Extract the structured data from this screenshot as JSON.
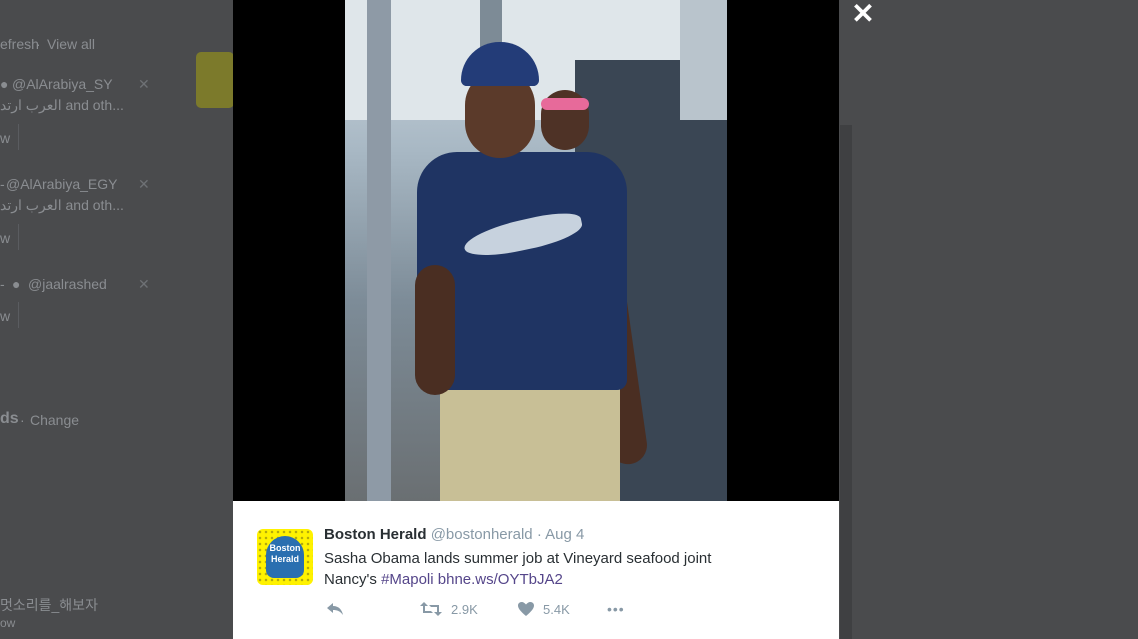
{
  "background": {
    "refresh": "efresh",
    "view_all": "View all",
    "suggestions": [
      {
        "handle": "@AlArabiya_SY",
        "sub": "العرب ارتد and oth...",
        "follow": "w"
      },
      {
        "handle": "@AlArabiya_EGY",
        "sub": "العرب ارتد and oth...",
        "follow": "w"
      },
      {
        "handle": "@jaalrashed",
        "sub": "",
        "follow": "w"
      }
    ],
    "trends_suffix": "ds",
    "change": "Change",
    "korean": "멋소리를_해보자",
    "korean_sub": "ow"
  },
  "viewer": {
    "close_label": "✕"
  },
  "tweet": {
    "name": "Boston Herald",
    "handle": "@bostonherald",
    "separator": "·",
    "date": "Aug 4",
    "text_line1": "Sasha Obama lands summer job at Vineyard seafood joint",
    "text_prefix": "Nancy's ",
    "hashtag": "#Mapoli",
    "link": "bhne.ws/OYTbJA2",
    "logo_text": "Boston Herald",
    "retweets": "2.9K",
    "likes": "5.4K",
    "more": "•••"
  },
  "colors": {
    "accent_link": "#55468a",
    "muted": "#8899a6",
    "snap_yellow": "#fff200"
  }
}
